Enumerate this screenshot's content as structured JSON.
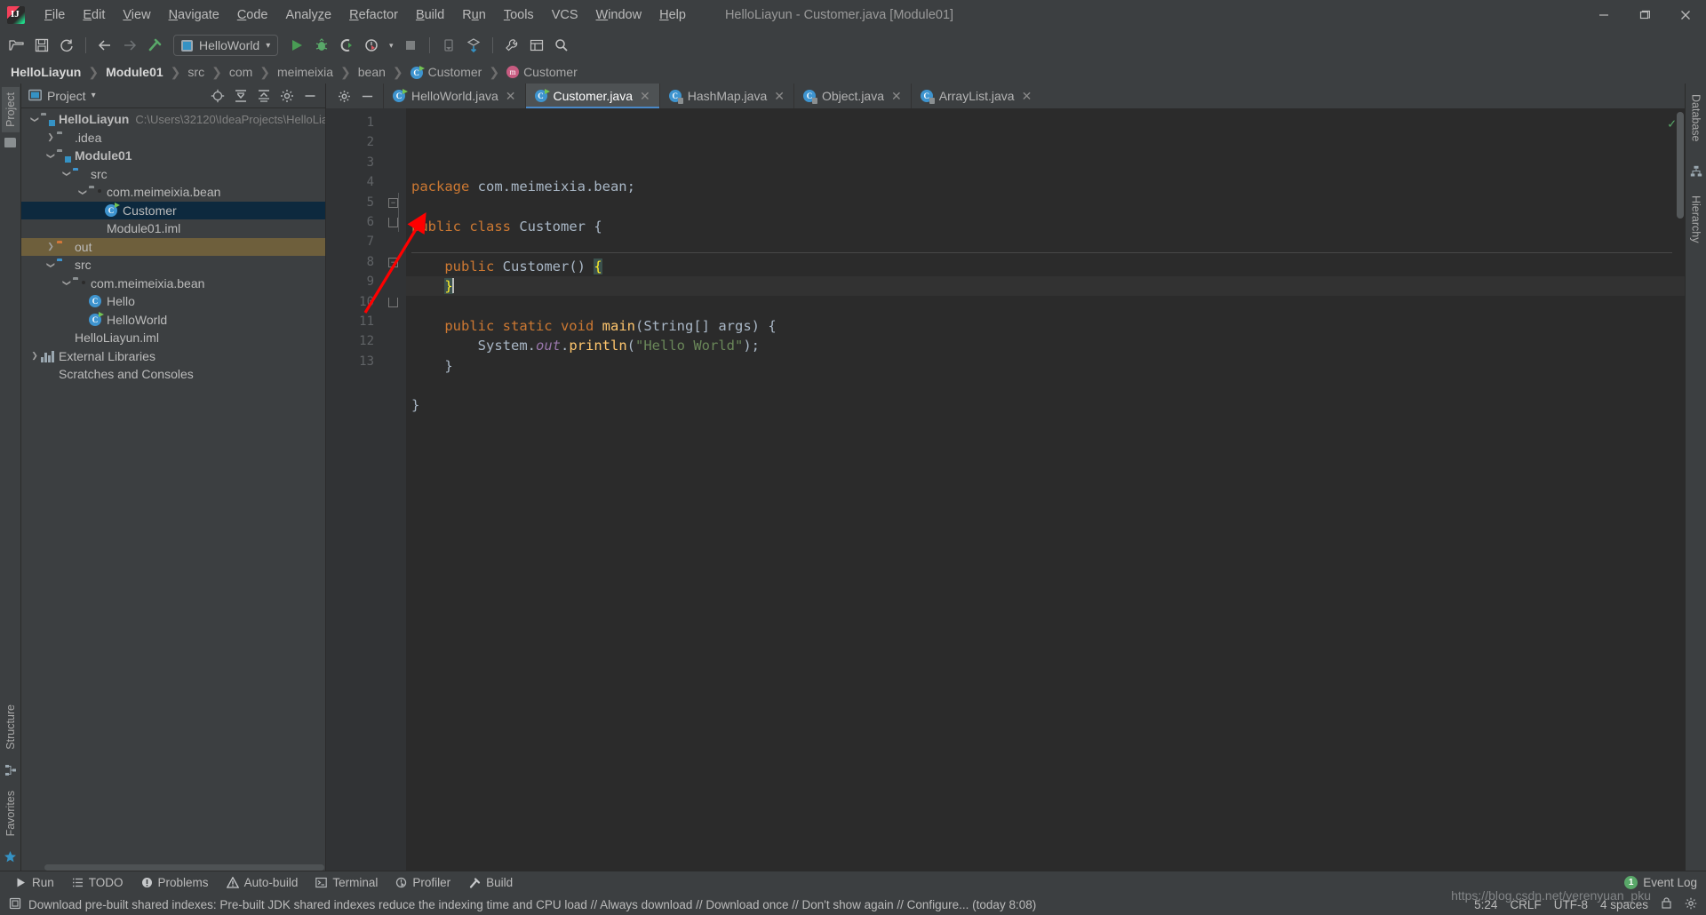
{
  "window": {
    "title": "HelloLiayun - Customer.java [Module01]",
    "logo_text": "IJ",
    "minimize": "─",
    "maximize": "❐",
    "close": "✕"
  },
  "menu": [
    {
      "label": "File",
      "mnemonic": "F"
    },
    {
      "label": "Edit",
      "mnemonic": "E"
    },
    {
      "label": "View",
      "mnemonic": "V"
    },
    {
      "label": "Navigate",
      "mnemonic": "N"
    },
    {
      "label": "Code",
      "mnemonic": "C"
    },
    {
      "label": "Analyze",
      "mnemonic": "z"
    },
    {
      "label": "Refactor",
      "mnemonic": "R"
    },
    {
      "label": "Build",
      "mnemonic": "B"
    },
    {
      "label": "Run",
      "mnemonic": "u"
    },
    {
      "label": "Tools",
      "mnemonic": "T"
    },
    {
      "label": "VCS",
      "mnemonic": ""
    },
    {
      "label": "Window",
      "mnemonic": "W"
    },
    {
      "label": "Help",
      "mnemonic": "H"
    }
  ],
  "toolbar": {
    "open_icon": "open-folder-icon",
    "save_icon": "save-icon",
    "sync_icon": "sync-icon",
    "back_icon": "back-arrow-icon",
    "forward_icon": "forward-arrow-icon",
    "build_icon": "build-hammer-icon",
    "run_config": "HelloWorld",
    "run_icon": "run-icon",
    "debug_icon": "debug-icon",
    "coverage_icon": "run-with-coverage-icon",
    "profile_icon": "profiler-icon",
    "stop_icon": "stop-icon",
    "search_icon": "search-icon"
  },
  "breadcrumb": [
    {
      "label": "HelloLiayun",
      "icon": "",
      "strong": true
    },
    {
      "label": "Module01",
      "icon": "",
      "strong": true
    },
    {
      "label": "src",
      "icon": "",
      "strong": false
    },
    {
      "label": "com",
      "icon": "",
      "strong": false
    },
    {
      "label": "meimeixia",
      "icon": "",
      "strong": false
    },
    {
      "label": "bean",
      "icon": "",
      "strong": false
    },
    {
      "label": "Customer",
      "icon": "class-icon",
      "strong": false
    },
    {
      "label": "Customer",
      "icon": "method-icon",
      "strong": false
    }
  ],
  "left_stripe": {
    "project_tab": "Project",
    "structure_tab": "Structure",
    "favorites_tab": "Favorites"
  },
  "right_stripe": {
    "database_tab": "Database",
    "hierarchy_tab": "Hierarchy"
  },
  "project_panel": {
    "title": "Project",
    "chevron": "▾",
    "actions": [
      "locate-icon",
      "expand-all-icon",
      "collapse-all-icon",
      "settings-gear-icon",
      "hide-panel-icon"
    ],
    "tree": [
      {
        "label": "HelloLiayun",
        "sub": "C:\\Users\\32120\\IdeaProjects\\HelloLia",
        "indent": 0,
        "arrow": "down",
        "icon": "project-folder-icon",
        "bold": true,
        "state": ""
      },
      {
        "label": ".idea",
        "sub": "",
        "indent": 1,
        "arrow": "right",
        "icon": "folder-gray-icon",
        "bold": false,
        "state": ""
      },
      {
        "label": "Module01",
        "sub": "",
        "indent": 1,
        "arrow": "down",
        "icon": "module-folder-icon",
        "bold": true,
        "state": ""
      },
      {
        "label": "src",
        "sub": "",
        "indent": 2,
        "arrow": "down",
        "icon": "source-folder-icon",
        "bold": false,
        "state": ""
      },
      {
        "label": "com.meimeixia.bean",
        "sub": "",
        "indent": 3,
        "arrow": "down",
        "icon": "package-icon",
        "bold": false,
        "state": ""
      },
      {
        "label": "Customer",
        "sub": "",
        "indent": 4,
        "arrow": "none",
        "icon": "class-run-icon",
        "bold": false,
        "state": "selected"
      },
      {
        "label": "Module01.iml",
        "sub": "",
        "indent": 3,
        "arrow": "none",
        "icon": "iml-file-icon",
        "bold": false,
        "state": ""
      },
      {
        "label": "out",
        "sub": "",
        "indent": 1,
        "arrow": "right",
        "icon": "excluded-folder-icon",
        "bold": false,
        "state": "excluded"
      },
      {
        "label": "src",
        "sub": "",
        "indent": 1,
        "arrow": "down",
        "icon": "source-folder-icon",
        "bold": false,
        "state": ""
      },
      {
        "label": "com.meimeixia.bean",
        "sub": "",
        "indent": 2,
        "arrow": "down",
        "icon": "package-icon",
        "bold": false,
        "state": ""
      },
      {
        "label": "Hello",
        "sub": "",
        "indent": 3,
        "arrow": "none",
        "icon": "class-icon",
        "bold": false,
        "state": ""
      },
      {
        "label": "HelloWorld",
        "sub": "",
        "indent": 3,
        "arrow": "none",
        "icon": "class-run-icon",
        "bold": false,
        "state": ""
      },
      {
        "label": "HelloLiayun.iml",
        "sub": "",
        "indent": 1,
        "arrow": "none",
        "icon": "iml-file-icon",
        "bold": false,
        "state": ""
      },
      {
        "label": "External Libraries",
        "sub": "",
        "indent": 0,
        "arrow": "right",
        "icon": "libraries-icon",
        "bold": false,
        "state": ""
      },
      {
        "label": "Scratches and Consoles",
        "sub": "",
        "indent": 0,
        "arrow": "none",
        "icon": "scratches-icon",
        "bold": false,
        "state": ""
      }
    ]
  },
  "editor": {
    "tabs": [
      {
        "label": "HelloWorld.java",
        "icon": "java-run-class-icon",
        "active": false,
        "close": "✕"
      },
      {
        "label": "Customer.java",
        "icon": "java-run-class-icon",
        "active": true,
        "close": "✕"
      },
      {
        "label": "HashMap.java",
        "icon": "java-readonly-class-icon",
        "active": false,
        "close": "✕"
      },
      {
        "label": "Object.java",
        "icon": "java-readonly-class-icon",
        "active": false,
        "close": "✕"
      },
      {
        "label": "ArrayList.java",
        "icon": "java-readonly-class-icon",
        "active": false,
        "close": "✕"
      }
    ],
    "line_numbers": [
      "1",
      "2",
      "3",
      "4",
      "5",
      "6",
      "7",
      "8",
      "9",
      "10",
      "11",
      "12",
      "13"
    ],
    "code_lines": [
      {
        "n": 1,
        "text": "package com.meimeixia.bean;"
      },
      {
        "n": 2,
        "text": ""
      },
      {
        "n": 3,
        "text": "public class Customer {"
      },
      {
        "n": 4,
        "text": ""
      },
      {
        "n": 5,
        "text": "    public Customer() {"
      },
      {
        "n": 6,
        "text": "    }"
      },
      {
        "n": 7,
        "text": ""
      },
      {
        "n": 8,
        "text": "    public static void main(String[] args) {"
      },
      {
        "n": 9,
        "text": "        System.out.println(\"Hello World\");"
      },
      {
        "n": 10,
        "text": "    }"
      },
      {
        "n": 11,
        "text": ""
      },
      {
        "n": 12,
        "text": "}"
      },
      {
        "n": 13,
        "text": ""
      }
    ],
    "inspection_status": "✓",
    "run_gutter_lines": [
      3,
      8
    ]
  },
  "bottom_tabs": [
    {
      "label": "Run",
      "icon": "run-icon"
    },
    {
      "label": "TODO",
      "icon": "todo-list-icon"
    },
    {
      "label": "Problems",
      "icon": "problems-icon"
    },
    {
      "label": "Auto-build",
      "icon": "warning-icon"
    },
    {
      "label": "Terminal",
      "icon": "terminal-icon"
    },
    {
      "label": "Profiler",
      "icon": "profiler-icon"
    },
    {
      "label": "Build",
      "icon": "build-hammer-icon"
    }
  ],
  "event_log": {
    "count": "1",
    "label": "Event Log"
  },
  "statusbar": {
    "notification_icon": "notification-icon",
    "message": "Download pre-built shared indexes: Pre-built JDK shared indexes reduce the indexing time and CPU load // Always download // Download once // Don't show again // Configure... (today 8:08)",
    "caret_position": "5:24",
    "line_separator": "CRLF",
    "encoding": "UTF-8",
    "indent": "4 spaces",
    "git_branch": "",
    "lock_icon": "read-only-icon",
    "inspection_icon": "inspections-gear-icon"
  },
  "watermark": "https://blog.csdn.net/yerenyuan_pku",
  "colors": {
    "accent": "#4a88c7",
    "background": "#3c3f41",
    "editor_bg": "#2b2b2b",
    "selection": "#0d293e",
    "excluded": "#6e5f3c",
    "keyword": "#cc7832",
    "string": "#6a8759",
    "field": "#9876aa",
    "method": "#ffc66d",
    "text": "#a9b7c6",
    "run_green": "#499c54",
    "annotation_red": "#ff0000"
  }
}
